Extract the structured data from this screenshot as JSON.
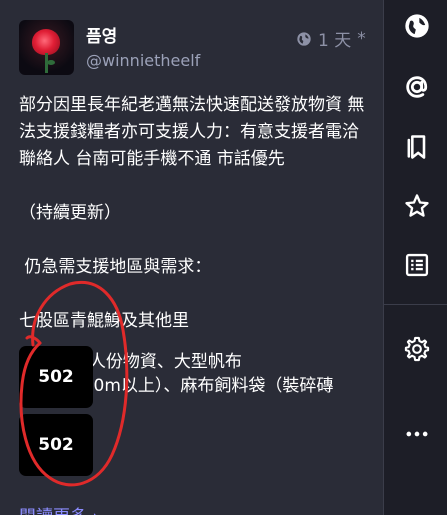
{
  "post": {
    "display_name": "픔영",
    "handle": "@winnietheelf",
    "time": "1 天",
    "edited_mark": "*",
    "content": [
      "部分因里長年紀老邁無法快速配送發放物資 無法支援錢糧者亦可支援人力：有意支援者電洽聯絡人 台南可能手機不通 市話優先",
      "",
      "（持續更新）",
      "",
      " 仍急需支援地區與需求：",
      "",
      "七股區青鯤鯓及其他里",
      "0人份物資、大型帆布",
      "（20m*20m以上）、麻布飼料袋（裝碎磚"
    ],
    "read_more": "閱讀更多 ›",
    "media": [
      {
        "label": "502"
      },
      {
        "label": "502"
      }
    ],
    "annotation_color": "#e02a2a"
  },
  "colors": {
    "background": "#2a2c37",
    "sidebar": "#1d1e27",
    "link": "#8c8dff",
    "muted": "#9ba1b8"
  },
  "sidebar": {
    "icons": [
      "globe-icon",
      "mention-icon",
      "bookmarks-icon",
      "star-icon",
      "list-icon",
      "gear-icon",
      "more-icon"
    ]
  }
}
